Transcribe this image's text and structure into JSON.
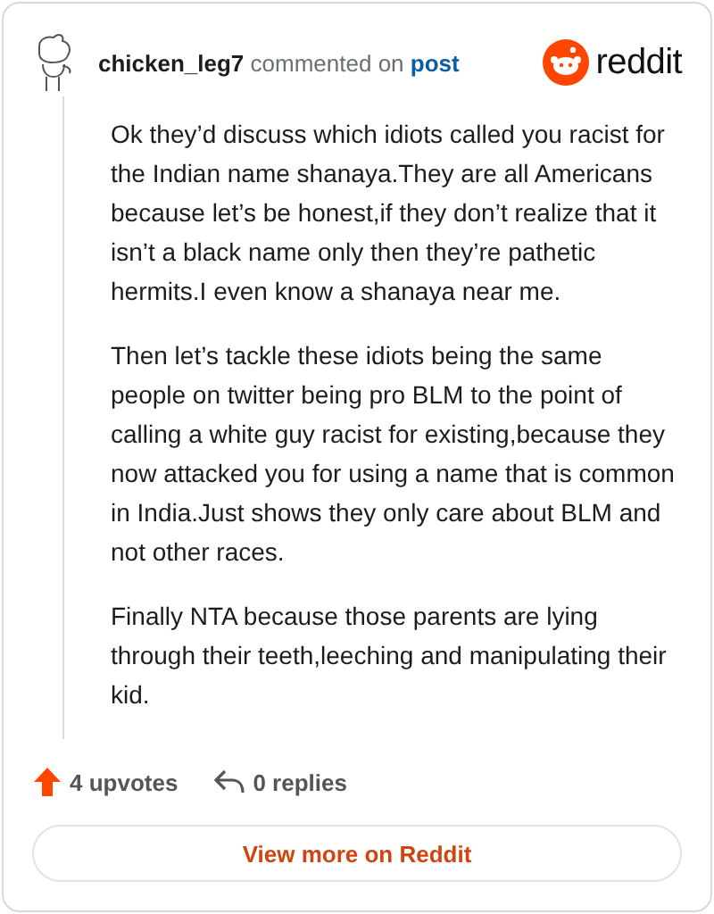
{
  "comment": {
    "author": "chicken_leg7",
    "action": "commented on",
    "link": "post",
    "paragraphs": [
      "Ok they’d discuss which idiots called you racist for the Indian name shanaya.They are all Americans because let’s be honest,if they don’t realize that it isn’t a black name only then they’re pathetic hermits.I even know a shanaya near me.",
      "Then let’s tackle these idiots being the same people on twitter being pro BLM to the point of calling a white guy racist for existing,because they now attacked you for using a name that is common in India.Just shows they only care about BLM and not other races.",
      "Finally NTA because those parents are lying through their teeth,leeching and manipulating their kid."
    ],
    "upvotes": "4 upvotes",
    "upvoted": true,
    "replies": "0 replies"
  },
  "brand": "reddit",
  "button": "View more on Reddit"
}
